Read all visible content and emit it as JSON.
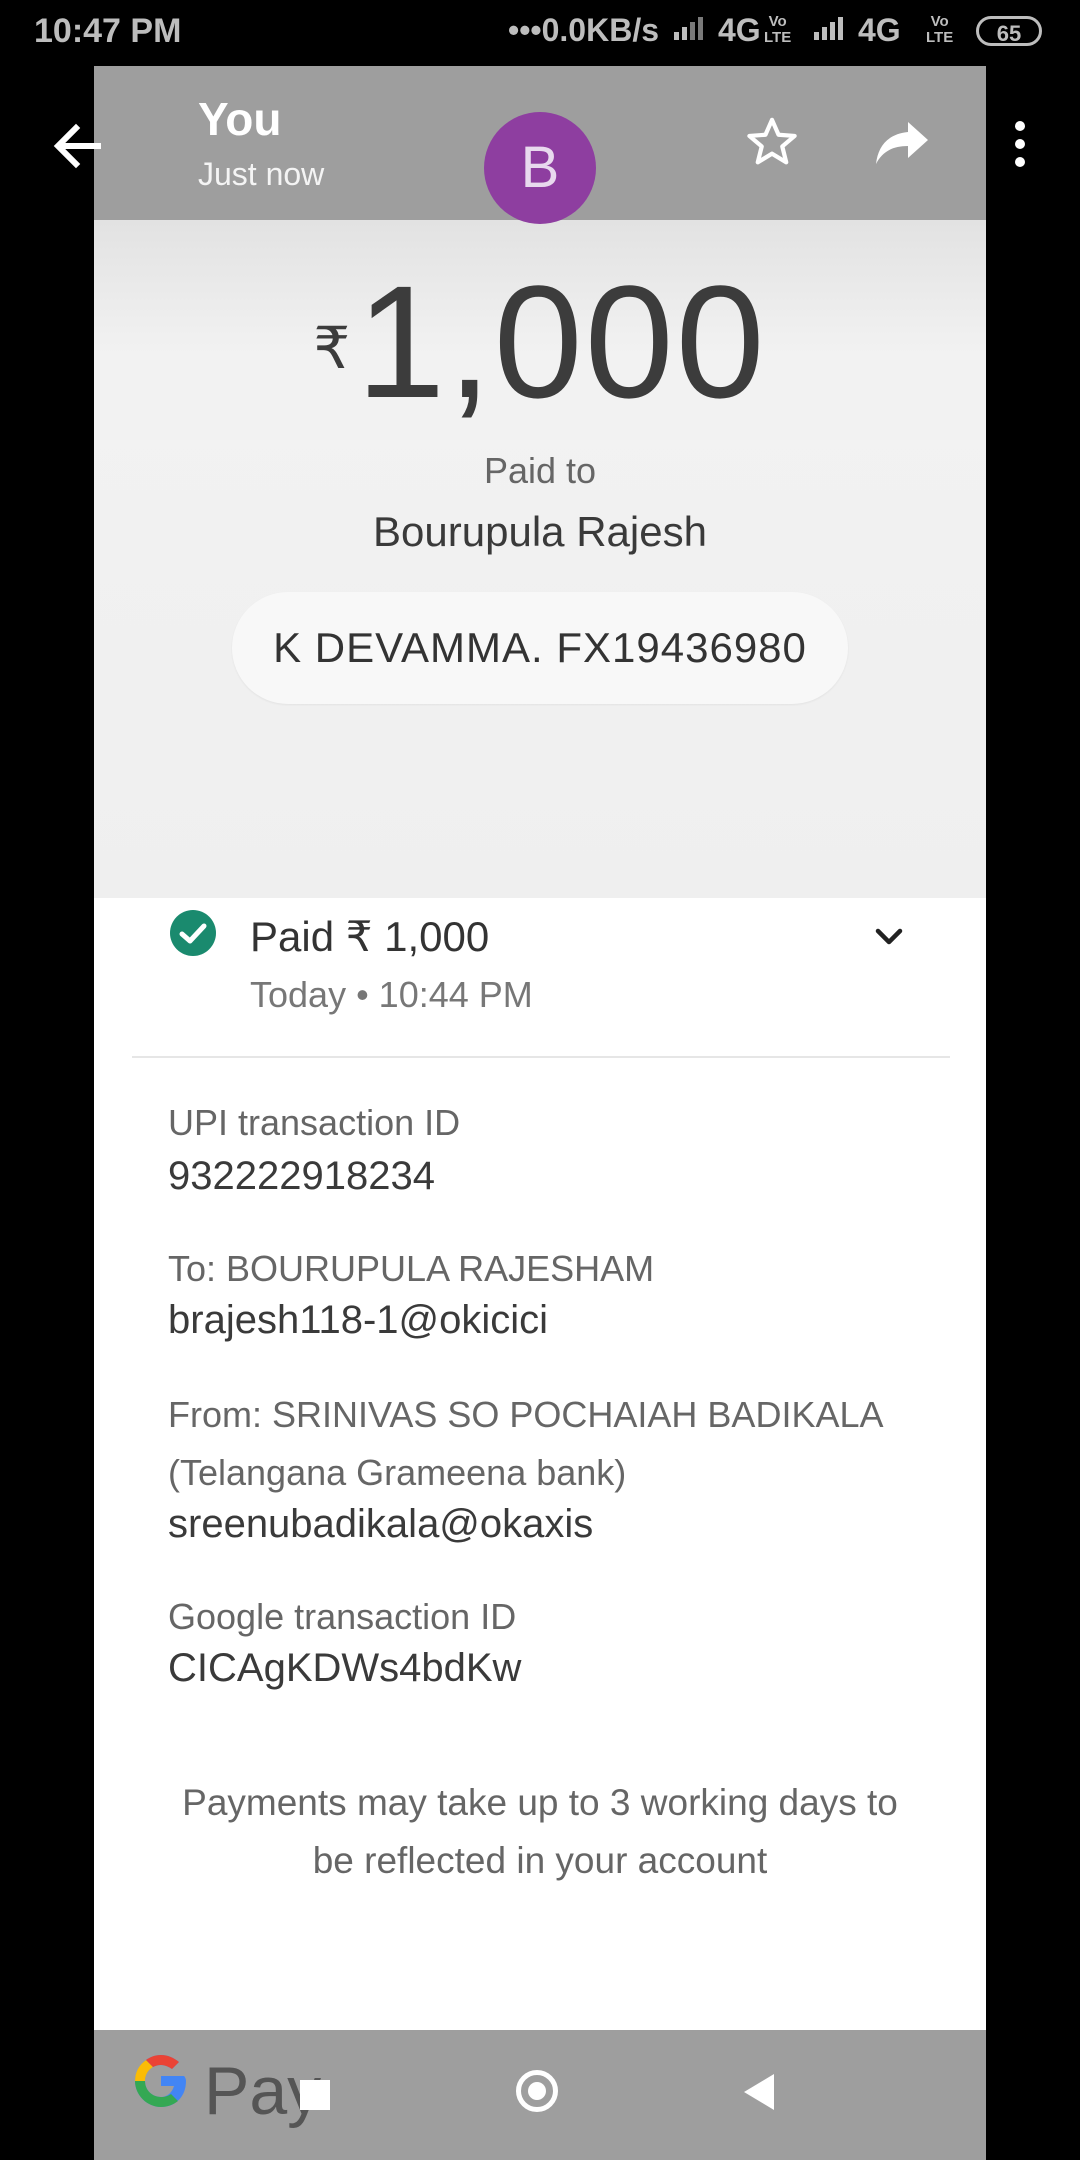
{
  "status_bar": {
    "time": "10:47 PM",
    "network_speed": "•••0.0KB/s",
    "network1": "4G",
    "network2": "4G",
    "volte_top": "Vo",
    "volte_bottom": "LTE",
    "battery": "65"
  },
  "header": {
    "title": "You",
    "subtitle": "Just now",
    "avatar_initial": "B",
    "icons": [
      "back-arrow-icon",
      "star-icon",
      "share-icon",
      "more-vert-icon"
    ]
  },
  "payment": {
    "currency_symbol": "₹",
    "amount": "1,000",
    "paid_to_label": "Paid to",
    "payee_name": "Bourupula Rajesh",
    "note": "K DEVAMMA. FX19436980"
  },
  "status": {
    "title": "Paid ₹ 1,000",
    "time": "Today • 10:44 PM",
    "color": "#1a8a6e"
  },
  "details": {
    "upi_label": "UPI transaction ID",
    "upi_value": "932222918234",
    "to_label": "To: BOURUPULA RAJESHAM",
    "to_value": "brajesh118-1@okicici",
    "from_label_line1": "From: SRINIVAS SO POCHAIAH BADIKALA",
    "from_label_line2": "(Telangana Grameena bank)",
    "from_value": "sreenubadikala@okaxis",
    "google_label": "Google transaction ID",
    "google_value": "CICAgKDWs4bdKw"
  },
  "footer_note": "Payments may take up to 3 working days to be reflected in your account",
  "brand": {
    "g": "G",
    "pay": "Pay"
  }
}
